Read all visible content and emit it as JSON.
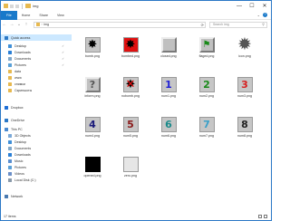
{
  "window": {
    "title": "img"
  },
  "window_controls": {
    "minimize": "—",
    "maximize": "☐",
    "close": "✕"
  },
  "ribbon": {
    "tabs": [
      "File",
      "Home",
      "Share",
      "View"
    ],
    "help": "?",
    "caret": "⌄"
  },
  "address": {
    "path": "img",
    "search_placeholder": "Search img"
  },
  "nav_buttons": {
    "back": "←",
    "forward": "→",
    "recent": "⌄",
    "up": "↑"
  },
  "navpane": {
    "items": [
      {
        "label": "Quick access",
        "selected": true,
        "icon_color": "#2b78c6"
      },
      {
        "label": "Desktop",
        "pinned": true,
        "icon_color": "#3f8fd8"
      },
      {
        "label": "Downloads",
        "pinned": true,
        "icon_color": "#2a7fd6"
      },
      {
        "label": "Documents",
        "pinned": true,
        "icon_color": "#7fa7c9"
      },
      {
        "label": "Pictures",
        "pinned": true,
        "icon_color": "#5aa0d8"
      },
      {
        "label": "data",
        "icon_color": "#e7b94f"
      },
      {
        "label": "www",
        "icon_color": "#e7b94f"
      },
      {
        "label": "снимки",
        "icon_color": "#e7b94f"
      },
      {
        "label": "Скриншоты",
        "icon_color": "#e7b94f"
      },
      {
        "label": "Dropbox",
        "icon_color": "#1f6fd6"
      },
      {
        "label": "OneDrive",
        "icon_color": "#2b78c6"
      },
      {
        "label": "This PC",
        "icon_color": "#4a8ad0"
      },
      {
        "label": "3D Objects",
        "icon_color": "#7aa8d8"
      },
      {
        "label": "Desktop",
        "icon_color": "#3f8fd8"
      },
      {
        "label": "Documents",
        "icon_color": "#7fa7c9"
      },
      {
        "label": "Downloads",
        "icon_color": "#2a7fd6"
      },
      {
        "label": "Music",
        "icon_color": "#5a8fd0"
      },
      {
        "label": "Pictures",
        "icon_color": "#5aa0d8"
      },
      {
        "label": "Videos",
        "icon_color": "#6b8fc8"
      },
      {
        "label": "Local Disk (C:)",
        "icon_color": "#8a9aaa"
      },
      {
        "label": "Network",
        "icon_color": "#4a7ab0"
      }
    ]
  },
  "files": [
    {
      "name": "bomb.png",
      "kind": "mine-gray",
      "glyph": "✸"
    },
    {
      "name": "bombed.png",
      "kind": "mine-red",
      "glyph": "✸"
    },
    {
      "name": "closed.png",
      "kind": "closed",
      "glyph": ""
    },
    {
      "name": "flaged.png",
      "kind": "flag",
      "glyph": "⚑"
    },
    {
      "name": "icon.png",
      "kind": "icon",
      "glyph": "✹"
    },
    {
      "name": "inform.png",
      "kind": "question",
      "glyph": "?"
    },
    {
      "name": "nobomb.png",
      "kind": "nobomb",
      "glyph": "✸"
    },
    {
      "name": "num1.png",
      "kind": "number",
      "glyph": "1",
      "color": "#1f1fd6"
    },
    {
      "name": "num2.png",
      "kind": "number",
      "glyph": "2",
      "color": "#1a8a1a"
    },
    {
      "name": "num3.png",
      "kind": "number",
      "glyph": "3",
      "color": "#d61f1f"
    },
    {
      "name": "num4.png",
      "kind": "number",
      "glyph": "4",
      "color": "#1a1a7a"
    },
    {
      "name": "num5.png",
      "kind": "number",
      "glyph": "5",
      "color": "#8a1a1a"
    },
    {
      "name": "num6.png",
      "kind": "number",
      "glyph": "6",
      "color": "#1a8a8a"
    },
    {
      "name": "num7.png",
      "kind": "number",
      "glyph": "7",
      "color": "#3aa0c8"
    },
    {
      "name": "num8.png",
      "kind": "number",
      "glyph": "8",
      "color": "#222222"
    },
    {
      "name": "opened.png",
      "kind": "opened",
      "glyph": ""
    },
    {
      "name": "zero.png",
      "kind": "zero",
      "glyph": ""
    }
  ],
  "status": {
    "count": "17 items"
  },
  "colors": {
    "accent": "#1979ca",
    "selection": "#cce8ff",
    "folder": "#e7b94f"
  }
}
